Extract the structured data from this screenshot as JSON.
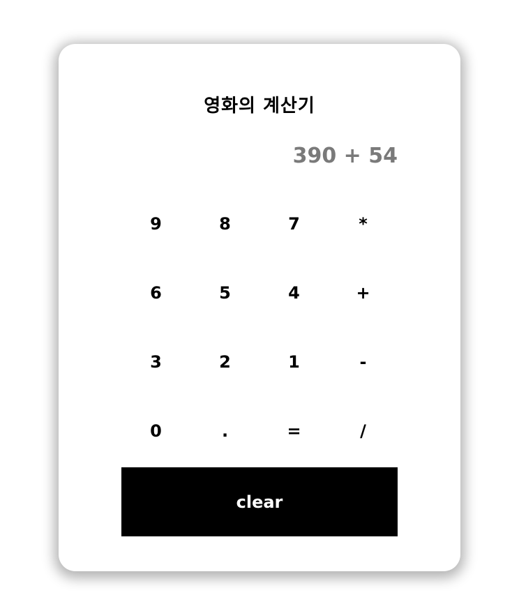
{
  "calculator": {
    "title": "영화의 계산기",
    "display": "390 + 54",
    "keys": {
      "k9": "9",
      "k8": "8",
      "k7": "7",
      "mul": "*",
      "k6": "6",
      "k5": "5",
      "k4": "4",
      "add": "+",
      "k3": "3",
      "k2": "2",
      "k1": "1",
      "sub": "-",
      "k0": "0",
      "dot": ".",
      "eq": "=",
      "div": "/"
    },
    "clear_label": "clear"
  },
  "colors": {
    "background": "#ffffff",
    "display_text": "#7a7a7a",
    "clear_button": "#000000",
    "clear_text": "#ffffff"
  }
}
